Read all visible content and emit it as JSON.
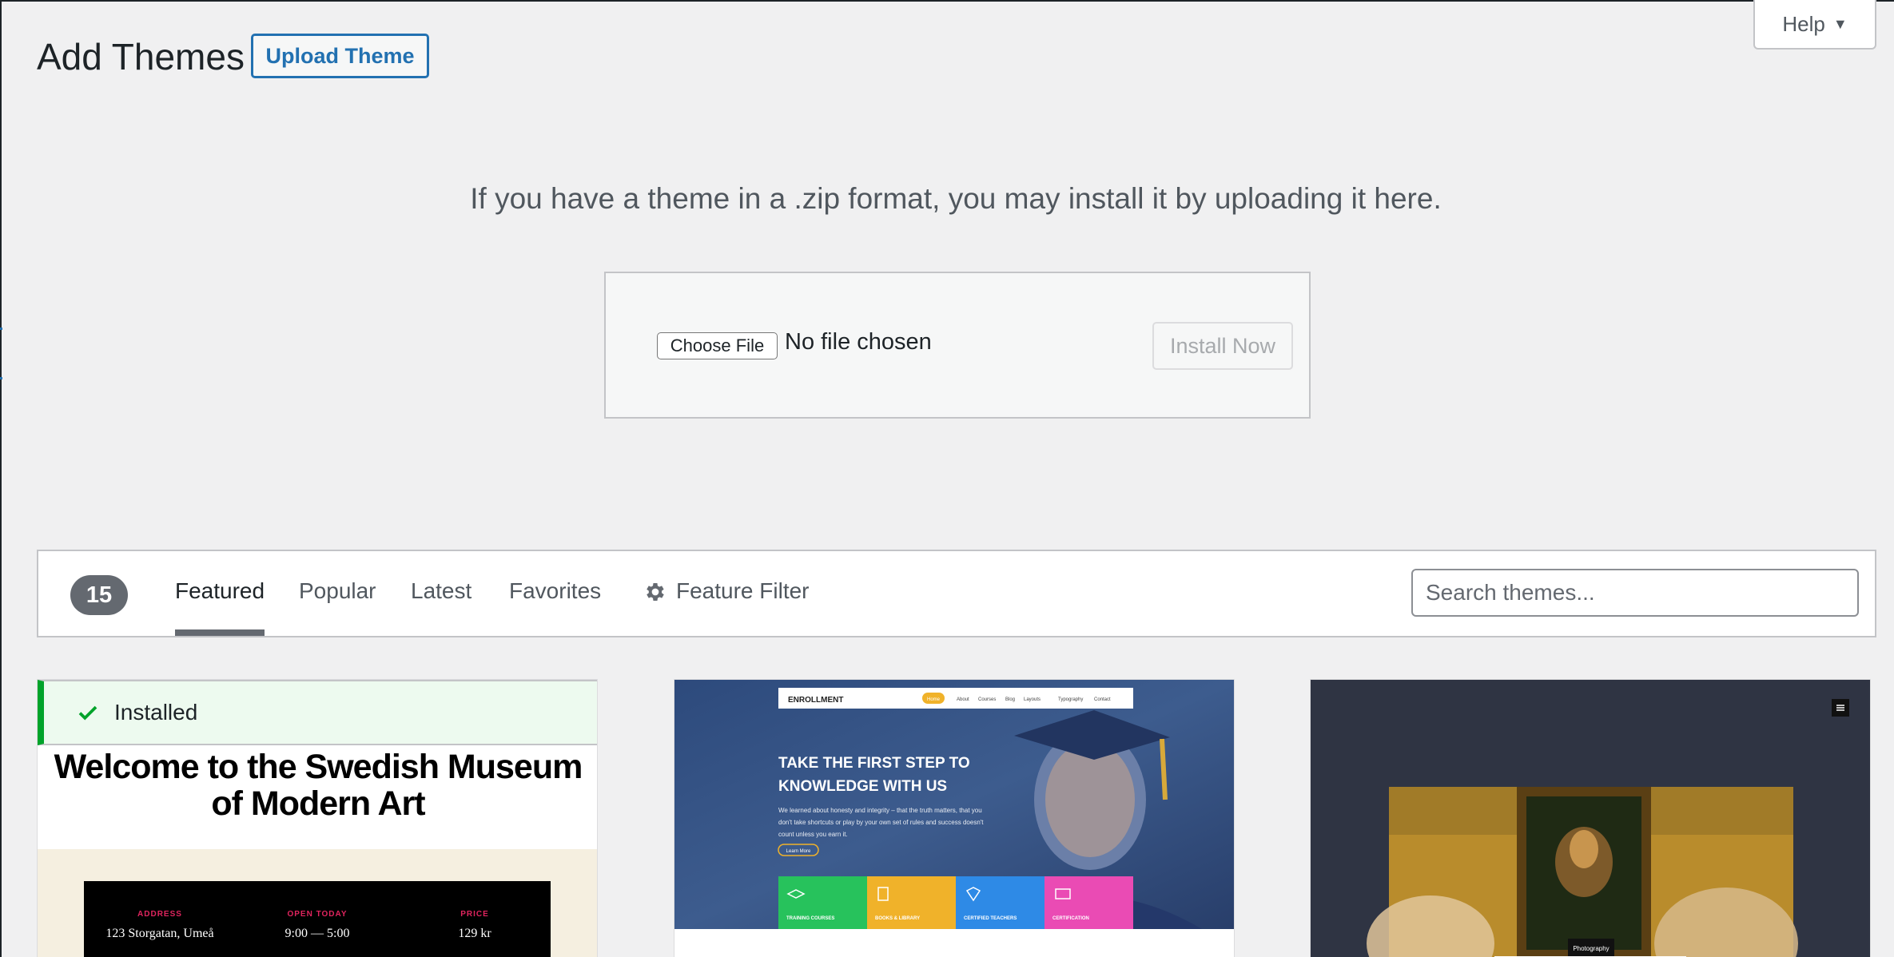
{
  "header": {
    "title": "Add Themes",
    "upload_button": "Upload Theme",
    "help_label": "Help"
  },
  "upload": {
    "help_text": "If you have a theme in a .zip format, you may install it by uploading it here.",
    "choose_file": "Choose File",
    "no_file": "No file chosen",
    "install_now": "Install Now"
  },
  "filter": {
    "count": "15",
    "tabs": [
      {
        "label": "Featured",
        "current": true
      },
      {
        "label": "Popular",
        "current": false
      },
      {
        "label": "Latest",
        "current": false
      },
      {
        "label": "Favorites",
        "current": false
      }
    ],
    "feature_filter": "Feature Filter",
    "search_placeholder": "Search themes..."
  },
  "themes": [
    {
      "installed_label": "Installed",
      "preview_title": "Welcome to the Swedish Museum of Modern Art",
      "info": [
        {
          "label": "ADDRESS",
          "value": "123 Storgatan, Umeå"
        },
        {
          "label": "OPEN TODAY",
          "value": "9:00 — 5:00"
        },
        {
          "label": "PRICE",
          "value": "129 kr"
        }
      ]
    },
    {
      "logo": "ENROLLMENT",
      "nav": [
        "Home",
        "About",
        "Courses",
        "Blog",
        "Layouts",
        "Typography",
        "Contact"
      ],
      "headline": "TAKE THE FIRST STEP TO KNOWLEDGE WITH US",
      "subtext": "We learned about honesty and integrity – that the truth matters, that you don't take shortcuts or play by your own set of rules and success doesn't count unless you earn it.",
      "cta": "Learn More",
      "features": [
        "TRAINING COURSES",
        "BOOKS & LIBRARY",
        "CERTIFIED TEACHERS",
        "CERTIFICATION"
      ]
    },
    {
      "caption": "Photography"
    }
  ],
  "colors": {
    "accent": "#2271b1",
    "installed_green": "#00a32a",
    "enroll_green": "#27c25c",
    "enroll_yellow": "#f0b22a",
    "enroll_blue": "#2e8ae6",
    "enroll_pink": "#ea4bb4"
  }
}
